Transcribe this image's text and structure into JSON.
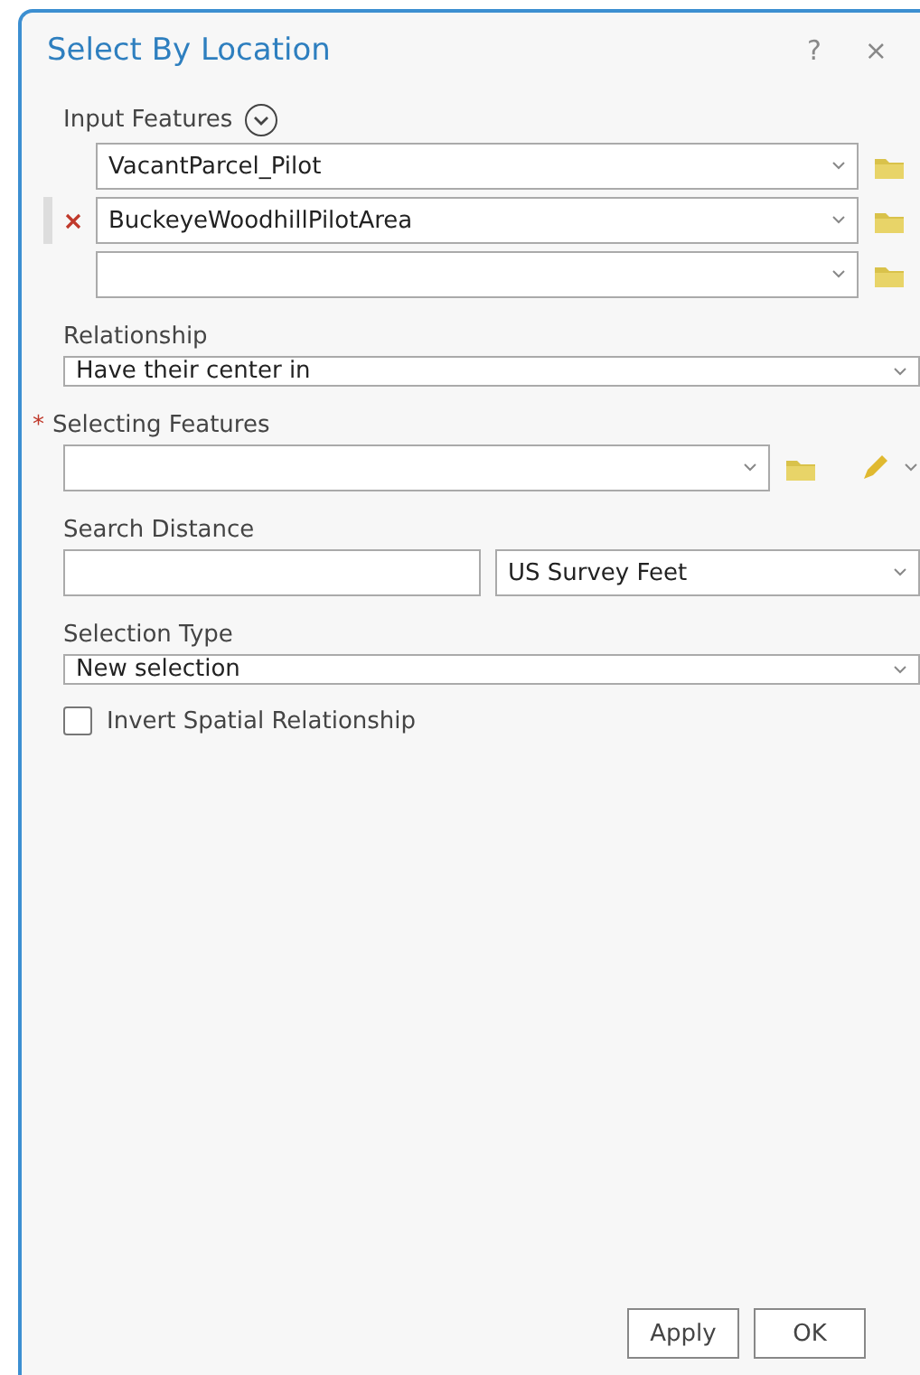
{
  "window": {
    "title": "Select By Location",
    "help": "?",
    "close": "×"
  },
  "input_features": {
    "label": "Input Features",
    "rows": [
      {
        "value": "VacantParcel_Pilot",
        "removable": false
      },
      {
        "value": "BuckeyeWoodhillPilotArea",
        "removable": true
      },
      {
        "removable": false
      }
    ]
  },
  "relationship": {
    "label": "Relationship",
    "value": "Have their center in"
  },
  "selecting_features": {
    "label": "Selecting Features",
    "required_mark": "*"
  },
  "search_distance": {
    "label": "Search Distance",
    "unit": "US Survey Feet"
  },
  "selection_type": {
    "label": "Selection Type",
    "value": "New selection"
  },
  "invert": {
    "label": "Invert Spatial Relationship",
    "checked": false
  },
  "buttons": [
    "Apply",
    "OK"
  ]
}
